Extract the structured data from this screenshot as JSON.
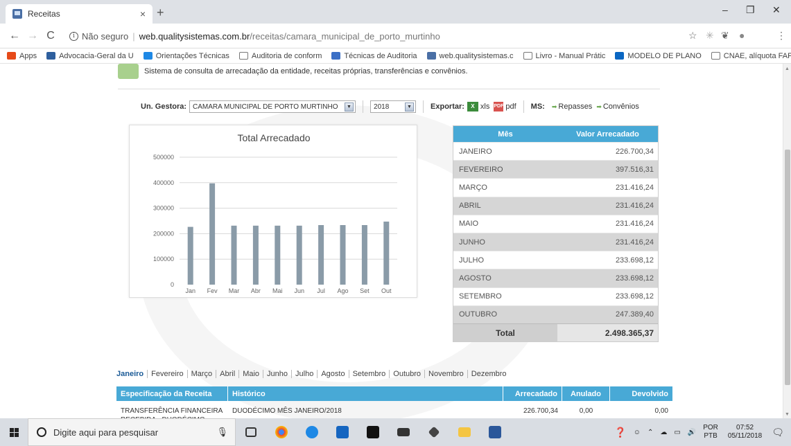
{
  "browser": {
    "tab_title": "Receitas",
    "tab_close": "×",
    "new_tab": "+",
    "minimize": "–",
    "restore": "❐",
    "close": "✕",
    "back": "←",
    "forward": "→",
    "reload": "C",
    "security_label": "Não seguro",
    "url_host": "web.qualitysistemas.com.br",
    "url_path": "/receitas/camara_municipal_de_porto_murtinho",
    "bookmarks": [
      {
        "label": "Apps",
        "icon": "apps-grid-icon",
        "color": "#e64a19"
      },
      {
        "label": "Advocacia-Geral da U",
        "icon": "agu-icon",
        "color": "#2e5f9e"
      },
      {
        "label": "Orientações Técnicas",
        "icon": "globe-icon",
        "color": "#1e88e5"
      },
      {
        "label": "Auditoria de conform",
        "icon": "page-icon",
        "color": "#ffffff"
      },
      {
        "label": "Técnicas de Auditoria",
        "icon": "chrome-icon",
        "color": "#3b6fc6"
      },
      {
        "label": "web.qualitysistemas.c",
        "icon": "receitas-icon",
        "color": "#4a6fa5"
      },
      {
        "label": "Livro - Manual Prátic",
        "icon": "page-icon",
        "color": "#ffffff"
      },
      {
        "label": "MODELO DE PLANO",
        "icon": "linkedin-icon",
        "color": "#0a66c2"
      },
      {
        "label": "CNAE, alíquota FAP e",
        "icon": "page-icon",
        "color": "#ffffff"
      }
    ]
  },
  "page": {
    "description": "Sistema de consulta de arrecadação da entidade, receitas próprias, transferências e convênios.",
    "filters": {
      "unit_label": "Un. Gestora:",
      "unit_value": "CAMARA MUNICIPAL DE PORTO MURTINHO",
      "year_value": "2018",
      "export_label": "Exportar:",
      "xls_label": "xls",
      "pdf_label": "pdf",
      "ms_label": "MS:",
      "repasses_label": "Repasses",
      "convenios_label": "Convênios"
    },
    "month_table": {
      "col_month": "Mês",
      "col_value": "Valor Arrecadado",
      "rows": [
        {
          "month": "JANEIRO",
          "value": "226.700,34"
        },
        {
          "month": "FEVEREIRO",
          "value": "397.516,31"
        },
        {
          "month": "MARÇO",
          "value": "231.416,24"
        },
        {
          "month": "ABRIL",
          "value": "231.416,24"
        },
        {
          "month": "MAIO",
          "value": "231.416,24"
        },
        {
          "month": "JUNHO",
          "value": "231.416,24"
        },
        {
          "month": "JULHO",
          "value": "233.698,12"
        },
        {
          "month": "AGOSTO",
          "value": "233.698,12"
        },
        {
          "month": "SETEMBRO",
          "value": "233.698,12"
        },
        {
          "month": "OUTUBRO",
          "value": "247.389,40"
        }
      ],
      "total_label": "Total",
      "total_value": "2.498.365,37"
    },
    "month_tabs": [
      "Janeiro",
      "Fevereiro",
      "Março",
      "Abril",
      "Maio",
      "Junho",
      "Julho",
      "Agosto",
      "Setembro",
      "Outubro",
      "Novembro",
      "Dezembro"
    ],
    "receita_table": {
      "headers": [
        "Especificação da Receita",
        "Histórico",
        "Arrecadado",
        "Anulado",
        "Devolvido"
      ],
      "rows": [
        {
          "especificacao": "TRANSFERÊNCIA FINANCEIRA RECEBIDA - DUODÉCIMO",
          "historico": "DUODÉCIMO MÊS JANEIRO/2018",
          "arrecadado": "226.700,34",
          "anulado": "0,00",
          "devolvido": "0,00"
        }
      ]
    }
  },
  "chart_data": {
    "type": "bar",
    "title": "Total Arrecadado",
    "categories": [
      "Jan",
      "Fev",
      "Mar",
      "Abr",
      "Mai",
      "Jun",
      "Jul",
      "Ago",
      "Set",
      "Out"
    ],
    "values": [
      226700.34,
      397516.31,
      231416.24,
      231416.24,
      231416.24,
      231416.24,
      233698.12,
      233698.12,
      233698.12,
      247389.4
    ],
    "yticks": [
      0,
      100000,
      200000,
      300000,
      400000,
      500000
    ],
    "ylim": [
      0,
      500000
    ],
    "grid": true,
    "bar_color": "#8a9ba8"
  },
  "taskbar": {
    "search_placeholder": "Digite aqui para pesquisar",
    "lang_top": "POR",
    "lang_bottom": "PTB",
    "time": "07:52",
    "date": "05/11/2018"
  }
}
